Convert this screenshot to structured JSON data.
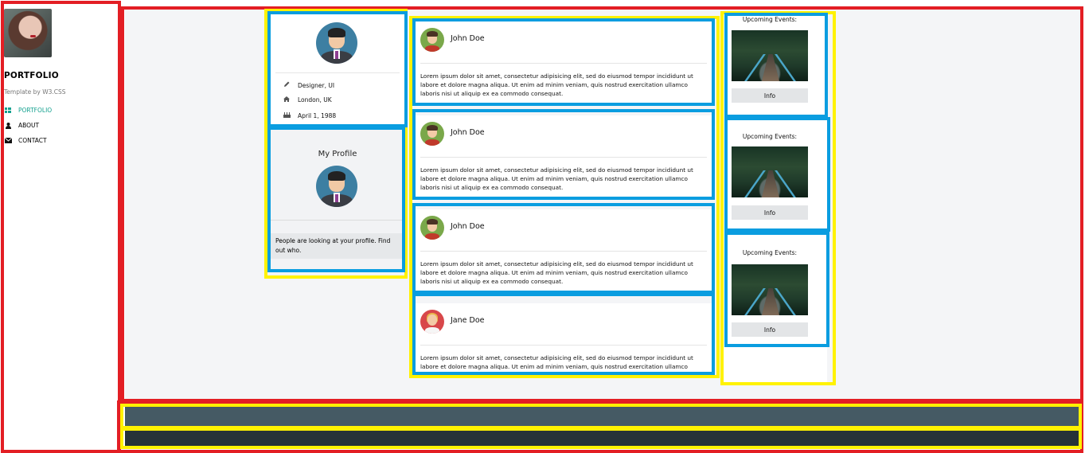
{
  "sidebar": {
    "brand": "PORTFOLIO",
    "subtitle": "Template by W3.CSS",
    "nav": [
      {
        "label": "PORTFOLIO",
        "icon": "grid-icon",
        "active": true
      },
      {
        "label": "ABOUT",
        "icon": "user-icon",
        "active": false
      },
      {
        "label": "CONTACT",
        "icon": "envelope-icon",
        "active": false
      }
    ]
  },
  "profile_card": {
    "rows": [
      {
        "icon": "pencil-icon",
        "text": "Designer, UI"
      },
      {
        "icon": "home-icon",
        "text": "London, UK"
      },
      {
        "icon": "birthday-cake-icon",
        "text": "April 1, 1988"
      }
    ]
  },
  "my_profile": {
    "title": "My Profile",
    "message": "People are looking at your profile. Find out who."
  },
  "posts": [
    {
      "name": "John Doe",
      "avatar": "male-avatar-icon",
      "text": "Lorem ipsum dolor sit amet, consectetur adipisicing elit, sed do eiusmod tempor incididunt ut labore et dolore magna aliqua. Ut enim ad minim veniam, quis nostrud exercitation ullamco laboris nisi ut aliquip ex ea commodo consequat."
    },
    {
      "name": "John Doe",
      "avatar": "male-avatar-icon",
      "text": "Lorem ipsum dolor sit amet, consectetur adipisicing elit, sed do eiusmod tempor incididunt ut labore et dolore magna aliqua. Ut enim ad minim veniam, quis nostrud exercitation ullamco laboris nisi ut aliquip ex ea commodo consequat."
    },
    {
      "name": "John Doe",
      "avatar": "male-avatar-icon",
      "text": "Lorem ipsum dolor sit amet, consectetur adipisicing elit, sed do eiusmod tempor incididunt ut labore et dolore magna aliqua. Ut enim ad minim veniam, quis nostrud exercitation ullamco laboris nisi ut aliquip ex ea commodo consequat."
    },
    {
      "name": "Jane Doe",
      "avatar": "female-avatar-icon",
      "text": "Lorem ipsum dolor sit amet, consectetur adipisicing elit, sed do eiusmod tempor incididunt ut labore et dolore magna aliqua. Ut enim ad minim veniam, quis nostrud exercitation ullamco laboris nisi ut aliquip ex ea commodo consequat."
    }
  ],
  "events": [
    {
      "title": "Upcoming Events:",
      "button": "Info"
    },
    {
      "title": "Upcoming Events:",
      "button": "Info"
    },
    {
      "title": "Upcoming Events:",
      "button": "Info"
    }
  ],
  "colors": {
    "annotation_red": "#e31e24",
    "annotation_yellow": "#fff200",
    "annotation_blue": "#0a9de0",
    "accent": "#14a18f",
    "footer_top": "#455a64",
    "footer_bottom": "#263238"
  }
}
